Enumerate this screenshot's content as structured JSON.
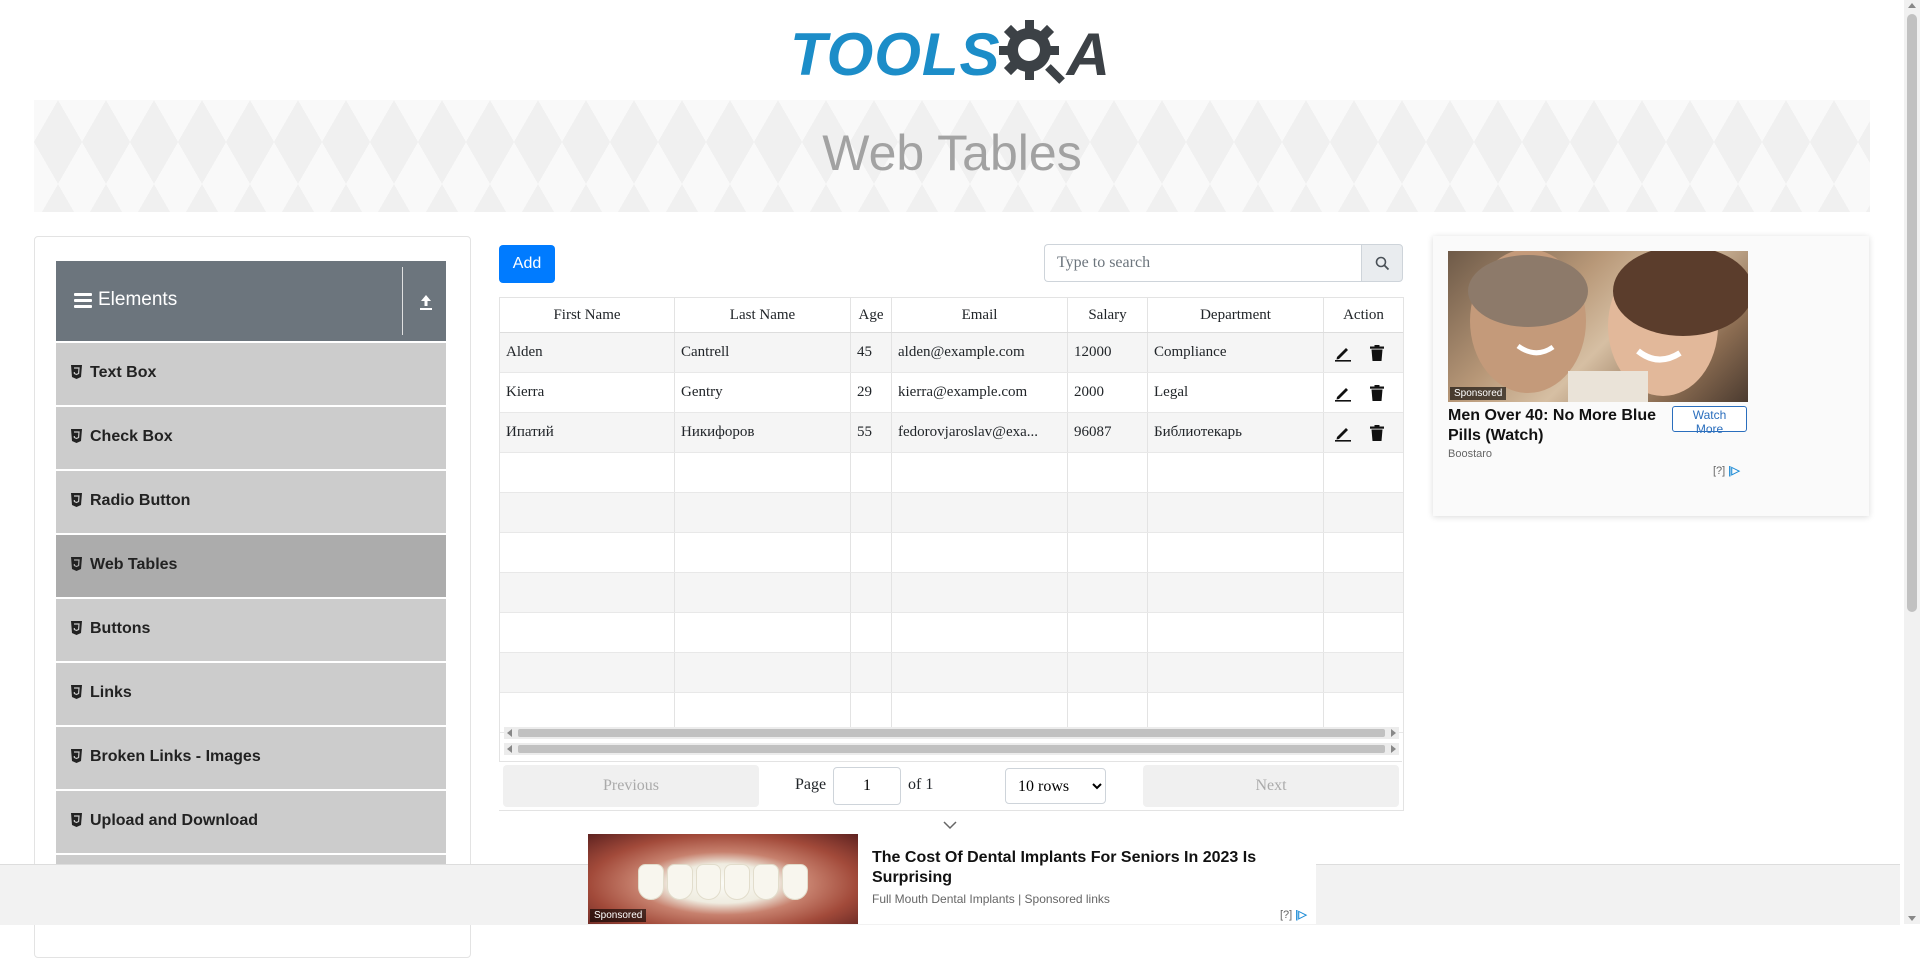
{
  "logo": {
    "part1": "TOOLS",
    "part2": "A"
  },
  "banner": {
    "title": "Web Tables"
  },
  "sidebar": {
    "group_title": "Elements",
    "items": [
      {
        "label": "Text Box",
        "active": false
      },
      {
        "label": "Check Box",
        "active": false
      },
      {
        "label": "Radio Button",
        "active": false
      },
      {
        "label": "Web Tables",
        "active": true
      },
      {
        "label": "Buttons",
        "active": false
      },
      {
        "label": "Links",
        "active": false
      },
      {
        "label": "Broken Links - Images",
        "active": false
      },
      {
        "label": "Upload and Download",
        "active": false
      }
    ]
  },
  "toolbar": {
    "add_label": "Add"
  },
  "search": {
    "placeholder": "Type to search",
    "value": ""
  },
  "table": {
    "columns": [
      "First Name",
      "Last Name",
      "Age",
      "Email",
      "Salary",
      "Department",
      "Action"
    ],
    "rows": [
      [
        "Alden",
        "Cantrell",
        "45",
        "alden@example.com",
        "12000",
        "Compliance"
      ],
      [
        "Kierra",
        "Gentry",
        "29",
        "kierra@example.com",
        "2000",
        "Legal"
      ],
      [
        "Ипатий",
        "Никифоров",
        "55",
        "fedorovjaroslav@exa...",
        "96087",
        "Библиотекарь"
      ]
    ],
    "empty_rows": 7
  },
  "pagination": {
    "previous": "Previous",
    "next": "Next",
    "page_label": "Page",
    "page_value": "1",
    "of_label": "of 1",
    "rows_selected": "10 rows"
  },
  "ad_right": {
    "sponsored": "Sponsored",
    "title": "Men Over 40: No More Blue Pills (Watch)",
    "cta": "Watch More",
    "source": "Boostaro",
    "choices": "[?]"
  },
  "ad_bottom": {
    "sponsored": "Sponsored",
    "title": "The Cost Of Dental Implants For Seniors In 2023 Is Surprising",
    "source": "Full Mouth Dental Implants | Sponsored links",
    "choices": "[?]"
  },
  "colors": {
    "primary": "#007bff",
    "sidebar_header": "#6c757d",
    "menu_item": "#cccccc",
    "menu_active": "#acacac",
    "logo_blue": "#1c8dc8"
  }
}
